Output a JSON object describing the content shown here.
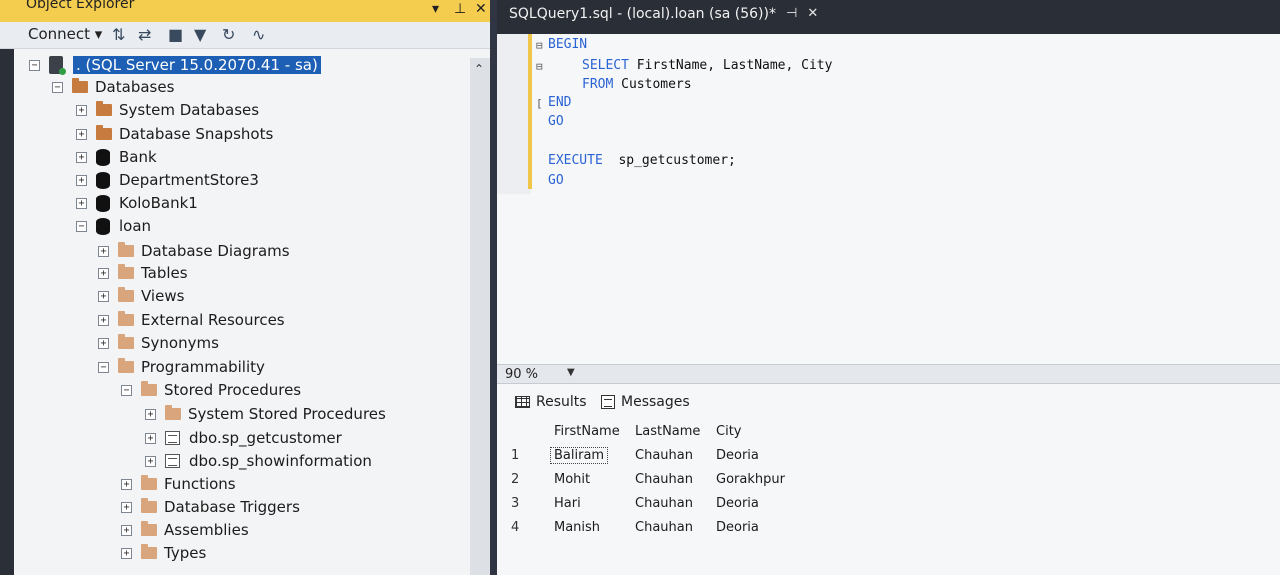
{
  "object_explorer": {
    "title": "Object Explorer",
    "title_buttons": [
      "▾",
      "⊥",
      "✕"
    ],
    "toolbar": {
      "connect_label": "Connect ▾",
      "icons": [
        "connect-icon",
        "disconnect-icon",
        "stop-icon",
        "filter-icon",
        "refresh-icon",
        "activity-monitor-icon"
      ]
    },
    "tree": [
      {
        "label": ". (SQL Server 15.0.2070.41 - sa)",
        "level": 0,
        "expander": "⊟",
        "icon": "server",
        "selected": true
      },
      {
        "label": "Databases",
        "level": 1,
        "expander": "⊟",
        "icon": "folder"
      },
      {
        "label": "System Databases",
        "level": 2,
        "expander": "⊞",
        "icon": "folder"
      },
      {
        "label": "Database Snapshots",
        "level": 2,
        "expander": "⊞",
        "icon": "folder"
      },
      {
        "label": "Bank",
        "level": 2,
        "expander": "⊞",
        "icon": "database"
      },
      {
        "label": "DepartmentStore3",
        "level": 2,
        "expander": "⊞",
        "icon": "database"
      },
      {
        "label": "KoloBank1",
        "level": 2,
        "expander": "⊞",
        "icon": "database"
      },
      {
        "label": "loan",
        "level": 2,
        "expander": "⊟",
        "icon": "database"
      },
      {
        "label": "Database Diagrams",
        "level": 3,
        "expander": "⊞",
        "icon": "folder"
      },
      {
        "label": "Tables",
        "level": 3,
        "expander": "⊞",
        "icon": "folder"
      },
      {
        "label": "Views",
        "level": 3,
        "expander": "⊞",
        "icon": "folder"
      },
      {
        "label": "External Resources",
        "level": 3,
        "expander": "⊞",
        "icon": "folder"
      },
      {
        "label": "Synonyms",
        "level": 3,
        "expander": "⊞",
        "icon": "folder"
      },
      {
        "label": "Programmability",
        "level": 3,
        "expander": "⊟",
        "icon": "folder"
      },
      {
        "label": "Stored Procedures",
        "level": 4,
        "expander": "⊟",
        "icon": "folder"
      },
      {
        "label": "System Stored Procedures",
        "level": 5,
        "expander": "⊞",
        "icon": "folder"
      },
      {
        "label": "dbo.sp_getcustomer",
        "level": 5,
        "expander": "⊞",
        "icon": "procedure"
      },
      {
        "label": "dbo.sp_showinformation",
        "level": 5,
        "expander": "⊞",
        "icon": "procedure"
      },
      {
        "label": "Functions",
        "level": 4,
        "expander": "⊞",
        "icon": "folder"
      },
      {
        "label": "Database Triggers",
        "level": 4,
        "expander": "⊞",
        "icon": "folder"
      },
      {
        "label": "Assemblies",
        "level": 4,
        "expander": "⊞",
        "icon": "folder"
      },
      {
        "label": "Types",
        "level": 4,
        "expander": "⊞",
        "icon": "folder"
      }
    ]
  },
  "editor": {
    "tab_title": "SQLQuery1.sql - (local).loan (sa (56))*",
    "tab_pin": "⊣",
    "tab_close": "✕",
    "code_lines": [
      {
        "kw": "BEGIN",
        "rest": "",
        "indent": 0,
        "outline": "⊟"
      },
      {
        "kw": "SELECT",
        "rest": " FirstName, LastName, City",
        "indent": 1,
        "outline": "⊟"
      },
      {
        "kw": "FROM",
        "rest": " Customers",
        "indent": 1,
        "outline": ""
      },
      {
        "kw": "END",
        "rest": "",
        "indent": 0,
        "outline": "["
      },
      {
        "kw": "GO",
        "rest": "",
        "indent": 0,
        "outline": ""
      },
      {
        "kw": "",
        "rest": "",
        "indent": 0,
        "outline": ""
      },
      {
        "kw": "EXECUTE",
        "rest": "  sp_getcustomer;",
        "indent": 0,
        "outline": ""
      },
      {
        "kw": "GO",
        "rest": "",
        "indent": 0,
        "outline": ""
      }
    ],
    "zoom": "90 %"
  },
  "results": {
    "tab_results": "Results",
    "tab_messages": "Messages",
    "columns": [
      "FirstName",
      "LastName",
      "City"
    ],
    "rows": [
      {
        "n": "1",
        "cells": [
          "Baliram",
          "Chauhan",
          "Deoria"
        ]
      },
      {
        "n": "2",
        "cells": [
          "Mohit",
          "Chauhan",
          "Gorakhpur"
        ]
      },
      {
        "n": "3",
        "cells": [
          "Hari",
          "Chauhan",
          "Deoria"
        ]
      },
      {
        "n": "4",
        "cells": [
          "Manish",
          "Chauhan",
          "Deoria"
        ]
      }
    ]
  },
  "colors": {
    "oe_titlebar": "#f5cd4e",
    "tab_bar": "#2a2e37",
    "keyword": "#2a63d4",
    "selection": "#1d5fb5",
    "folder": "#c77b3e"
  }
}
